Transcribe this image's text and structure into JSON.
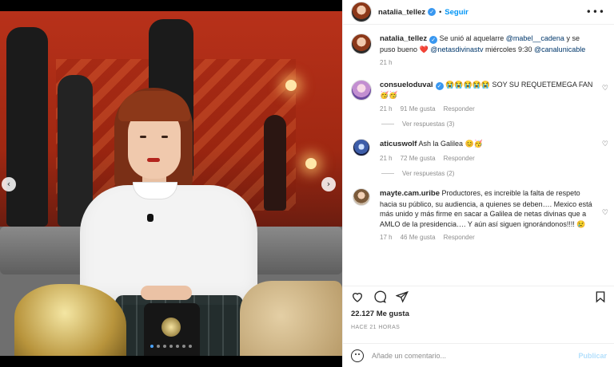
{
  "post": {
    "username": "natalia_tellez",
    "follow_label": "Seguir",
    "separator": "•",
    "more_icon": "more-horizontal-icon"
  },
  "media": {
    "prev_glyph": "‹",
    "next_glyph": "›",
    "dots_count": 7,
    "active_dot": 0
  },
  "caption": {
    "username": "natalia_tellez",
    "text_1": "Se unió al aquelarre",
    "mention_1": "@mabel__cadena",
    "text_2": "y se puso bueno",
    "heart": "❤️",
    "mention_2": "@netasdivinastv",
    "text_3": "miércoles 9:30",
    "mention_3": "@canalunicable",
    "time": "21 h"
  },
  "comments": [
    {
      "username": "consueloduval",
      "text": "😭😭😭😭😭 SOY SU REQUETEMEGA FAN🥳🥳",
      "time": "21 h",
      "likes": "91 Me gusta",
      "reply": "Responder",
      "view_replies": "Ver respuestas (3)"
    },
    {
      "username": "aticuswolf",
      "text": "Ash la Galilea 😊🥳",
      "time": "21 h",
      "likes": "72 Me gusta",
      "reply": "Responder",
      "view_replies": "Ver respuestas (2)"
    },
    {
      "username": "mayte.cam.uribe",
      "text": "Productores, es increible la falta de respeto hacia su público, su audiencia, a quienes se deben…. Mexico está más unido y más firme en sacar a Galilea de netas divinas que a AMLO de la presidencia…. Y aún así siguen ignorándonos!!!! 😢",
      "time": "17 h",
      "likes": "46 Me gusta",
      "reply": "Responder"
    }
  ],
  "footer": {
    "likes_count": "22.127",
    "likes_label": "Me gusta",
    "time": "HACE 21 HORAS",
    "comment_placeholder": "Añade un comentario...",
    "publish_label": "Publicar"
  },
  "colors": {
    "accent": "#0095f6",
    "verified": "#3897f0",
    "muted": "#8e8e8e",
    "publish_disabled": "#b2dffc"
  }
}
